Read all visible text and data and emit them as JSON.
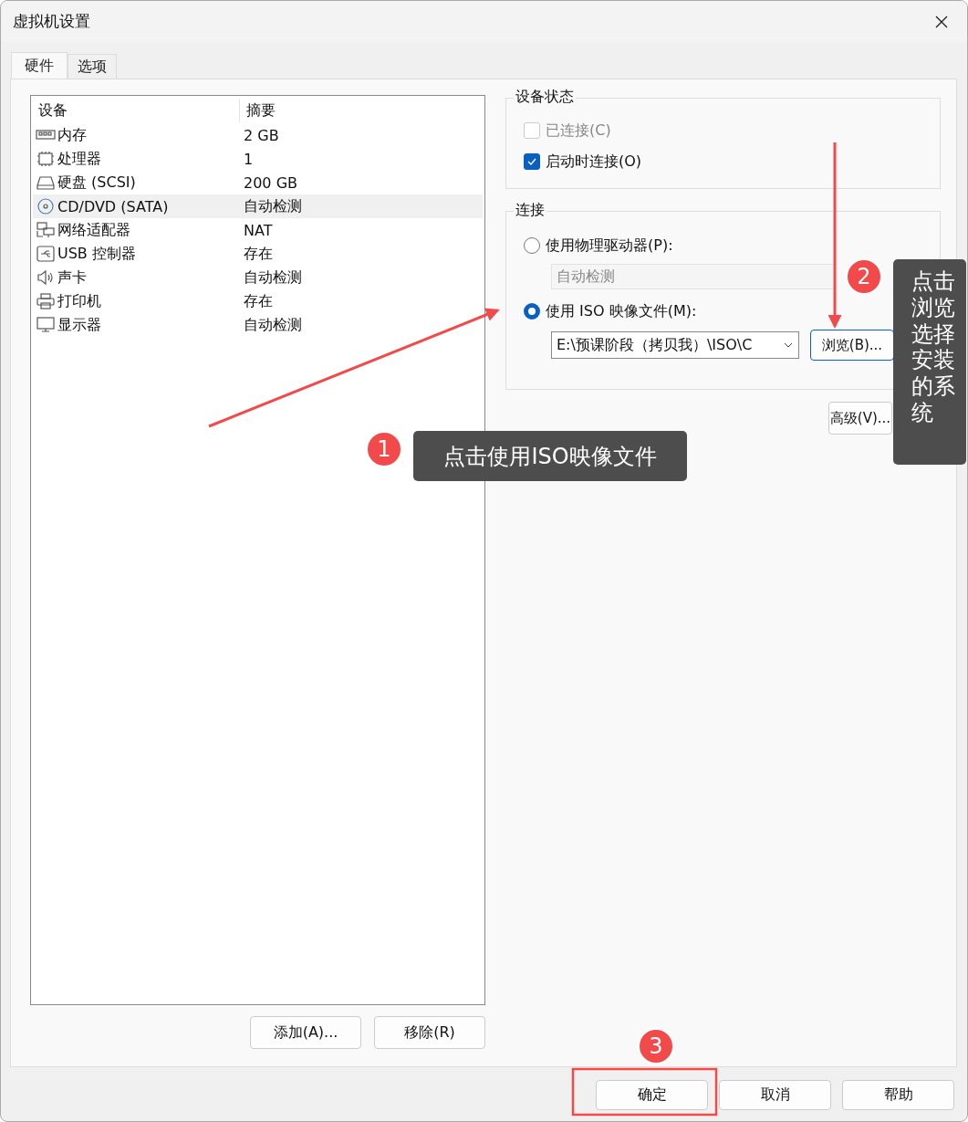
{
  "window": {
    "title": "虚拟机设置"
  },
  "tabs": [
    {
      "label": "硬件",
      "selected": true
    },
    {
      "label": "选项",
      "selected": false
    }
  ],
  "device_table": {
    "columns": [
      "设备",
      "摘要"
    ],
    "rows": [
      {
        "device": "内存",
        "summary": "2 GB",
        "selected": false
      },
      {
        "device": "处理器",
        "summary": "1",
        "selected": false
      },
      {
        "device": "硬盘 (SCSI)",
        "summary": "200 GB",
        "selected": false
      },
      {
        "device": "CD/DVD (SATA)",
        "summary": "自动检测",
        "selected": true
      },
      {
        "device": "网络适配器",
        "summary": "NAT",
        "selected": false
      },
      {
        "device": "USB 控制器",
        "summary": "存在",
        "selected": false
      },
      {
        "device": "声卡",
        "summary": "自动检测",
        "selected": false
      },
      {
        "device": "打印机",
        "summary": "存在",
        "selected": false
      },
      {
        "device": "显示器",
        "summary": "自动检测",
        "selected": false
      }
    ]
  },
  "list_buttons": [
    "添加(A)...",
    "移除(R)"
  ],
  "device_status": {
    "title": "设备状态",
    "options": [
      {
        "label": "已连接(C)",
        "checked": false,
        "disabled": true
      },
      {
        "label": "启动时连接(O)",
        "checked": true,
        "disabled": false
      }
    ]
  },
  "connection": {
    "title": "连接",
    "physical_drive": {
      "label": "使用物理驱动器(P):",
      "selected": false,
      "value": "自动检测",
      "disabled": true
    },
    "iso_file": {
      "label": "使用 ISO 映像文件(M):",
      "selected": true,
      "value": "E:\\预课阶段（拷贝我）\\ISO\\C"
    },
    "browse_button": "浏览(B)..."
  },
  "advanced_button": "高级(V)...",
  "footer_buttons": [
    "确定",
    "取消",
    "帮助"
  ],
  "annotations": [
    {
      "number": "1",
      "text": "点击使用ISO映像文件"
    },
    {
      "number": "2",
      "text": "点击浏览选择安装的系统"
    },
    {
      "number": "3"
    }
  ]
}
